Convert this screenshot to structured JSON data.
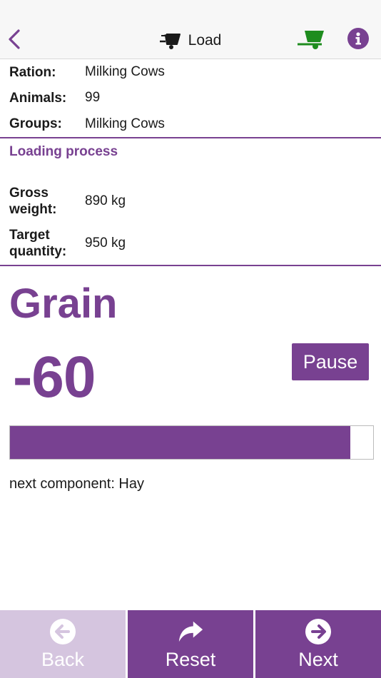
{
  "header": {
    "title": "Load",
    "icons": {
      "back": "chevron-left-icon",
      "title": "cart-icon",
      "status": "green-cart-icon",
      "info": "info-icon"
    },
    "status_color": "#1e8c1e"
  },
  "info": {
    "ration_label": "Ration:",
    "ration_value": "Milking Cows",
    "animals_label": "Animals:",
    "animals_value": "99",
    "groups_label": "Groups:",
    "groups_value": "Milking Cows"
  },
  "process": {
    "title": "Loading process",
    "gross_label": "Gross weight:",
    "gross_value": "890 kg",
    "target_label": "Target quantity:",
    "target_value": "950 kg"
  },
  "loading": {
    "component": "Grain",
    "amount": "-60",
    "pause_label": "Pause",
    "progress": 0.937,
    "next_component": "next component: Hay"
  },
  "footer": {
    "back_label": "Back",
    "reset_label": "Reset",
    "next_label": "Next"
  },
  "colors": {
    "accent": "#784191",
    "disabled": "#d5c5df"
  }
}
